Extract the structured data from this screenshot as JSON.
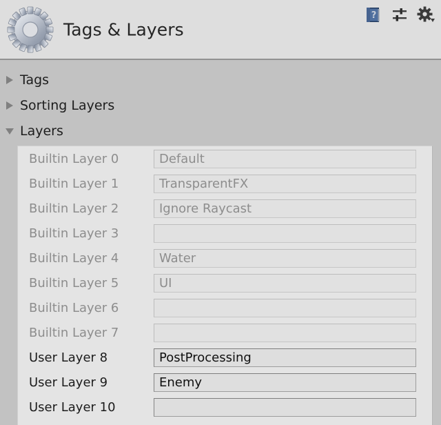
{
  "window": {
    "title": "Tags & Layers",
    "logo_icon": "gear-icon"
  },
  "header_icons": [
    {
      "name": "help-icon",
      "glyph": "?"
    },
    {
      "name": "preset-icon",
      "glyph": ""
    },
    {
      "name": "settings-gear-icon",
      "glyph": ""
    }
  ],
  "foldouts": [
    {
      "label": "Tags",
      "expanded": false,
      "icon": "chevron-right-icon"
    },
    {
      "label": "Sorting Layers",
      "expanded": false,
      "icon": "chevron-right-icon"
    },
    {
      "label": "Layers",
      "expanded": true,
      "icon": "chevron-down-icon"
    }
  ],
  "layers": [
    {
      "label": "Builtin Layer 0",
      "value": "Default",
      "enabled": false
    },
    {
      "label": "Builtin Layer 1",
      "value": "TransparentFX",
      "enabled": false
    },
    {
      "label": "Builtin Layer 2",
      "value": "Ignore Raycast",
      "enabled": false
    },
    {
      "label": "Builtin Layer 3",
      "value": "",
      "enabled": false
    },
    {
      "label": "Builtin Layer 4",
      "value": "Water",
      "enabled": false
    },
    {
      "label": "Builtin Layer 5",
      "value": "UI",
      "enabled": false
    },
    {
      "label": "Builtin Layer 6",
      "value": "",
      "enabled": false
    },
    {
      "label": "Builtin Layer 7",
      "value": "",
      "enabled": false
    },
    {
      "label": "User Layer 8",
      "value": "PostProcessing",
      "enabled": true
    },
    {
      "label": "User Layer 9",
      "value": "Enemy",
      "enabled": true
    },
    {
      "label": "User Layer 10",
      "value": "",
      "enabled": true
    }
  ],
  "colors": {
    "header_bg": "#dedede",
    "body_bg": "#c2c2c2",
    "panel_bg": "#e4e4e4",
    "label_disabled": "#8d8d8d",
    "label_enabled": "#1b1b1b",
    "foldout_arrow": "#808080",
    "help_icon_blue": "#35527e"
  }
}
